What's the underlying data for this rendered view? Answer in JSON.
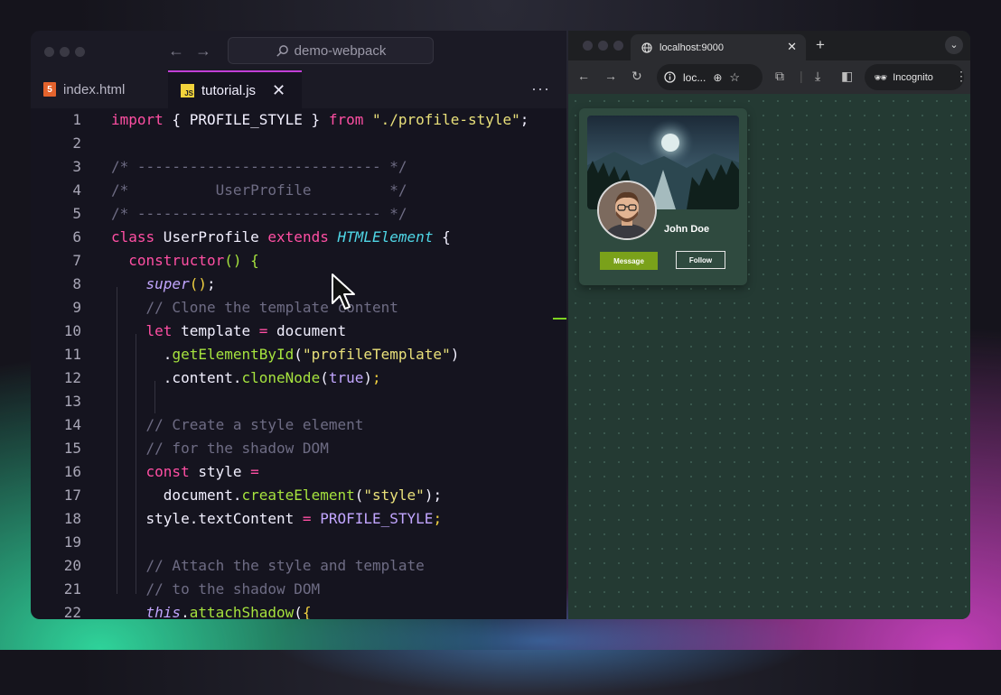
{
  "editor": {
    "search": "demo-webpack",
    "tabs": [
      {
        "label": "index.html",
        "icon": "html5-icon"
      },
      {
        "label": "tutorial.js",
        "icon": "js-icon",
        "active": true
      }
    ],
    "more_label": "···",
    "line_numbers": [
      "1",
      "2",
      "3",
      "4",
      "5",
      "6",
      "7",
      "8",
      "9",
      "10",
      "11",
      "12",
      "13",
      "14",
      "15",
      "16",
      "17",
      "18",
      "19",
      "20",
      "21",
      "22"
    ]
  },
  "browser": {
    "tab_title": "localhost:9000",
    "address": "loc...",
    "incognito_label": "Incognito",
    "card": {
      "name": "John Doe",
      "message_button": "Message",
      "follow_button": "Follow"
    }
  },
  "colors": {
    "accent_tab": "#c13fd6",
    "keyword": "#ff4fa3",
    "string": "#e9e07a",
    "function": "#a6e33e",
    "class": "#4fd6e6",
    "comment": "#6e6c84",
    "message_button": "#7aa11a"
  }
}
